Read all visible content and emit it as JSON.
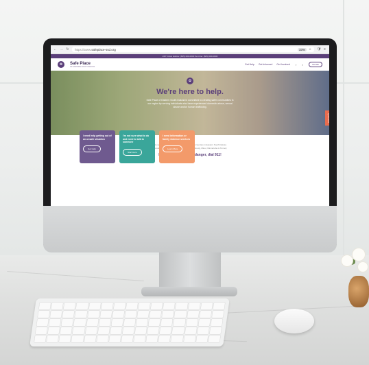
{
  "browser": {
    "url_prefix": "https://www.",
    "url_domain": "safeplace-ssd.org",
    "zoom": "33%",
    "nav_back": "←",
    "nav_forward": "→",
    "nav_reload": "↻",
    "star_icon": "☆",
    "shield_icon": "🛡",
    "menu_icon": "≡"
  },
  "site": {
    "topbar_text": "24/7 Crisis Hotline: (605) 000-0000  Text line: (605) 000-0000",
    "logo_name": "Safe Place",
    "logo_sub": "OF EASTERN SOUTH DAKOTA",
    "nav_links": [
      "Get Help",
      "Get Informed",
      "Get Involved"
    ],
    "donate_label": "Donate",
    "hero_title": "We're here to help.",
    "hero_body": "Safe Place of Eastern South Dakota is committed to creating safer communities in our region by serving individuals who have experienced domestic abuse, sexual abuse and/or human trafficking.",
    "side_tab": "QUICK EXIT",
    "intro_line1": "We serve a diverse population that includes 8 counties in Eastern South Dakota",
    "intro_line2": "(Brookings, Deuel, Hamlin, Kingsbury, Lake, Moody, Miner, Minnehaha & Turner)",
    "danger_text": "If you're in immediate danger, dial 911!",
    "cards": [
      {
        "title": "I need help getting out of an unsafe situation",
        "button": "Get Help",
        "color": "#6f5a8f"
      },
      {
        "title": "I'm not sure what to do and need to talk to someone",
        "button": "Start Here",
        "color": "#3aa69a"
      },
      {
        "title": "I need information or family violence services",
        "button": "Learn More",
        "color": "#f39a6a"
      }
    ]
  }
}
